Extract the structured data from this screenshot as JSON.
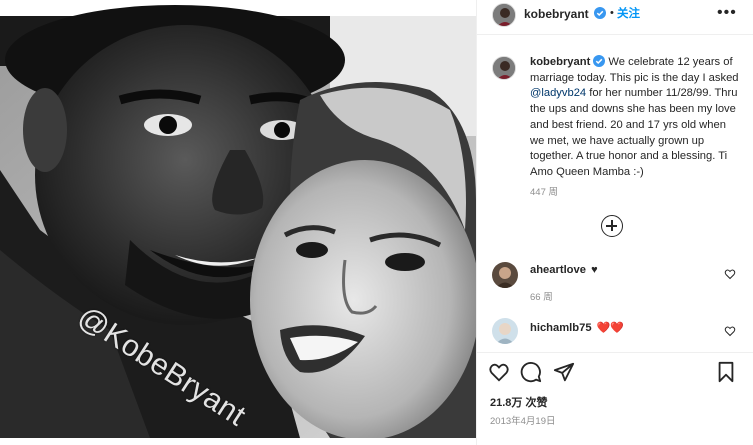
{
  "post": {
    "photo_watermark": "@KobeBryant"
  },
  "header": {
    "username": "kobebryant",
    "separator": "•",
    "follow_label": "关注",
    "more_label": "•••"
  },
  "caption": {
    "username": "kobebryant",
    "text_before_mention": "We celebrate 12 years of marriage today. This pic is the day I asked ",
    "mention": "@ladyvb24",
    "text_after_mention": " for her number 11/28/99. Thru the ups and downs she has been my love and best friend. 20 and 17 yrs old when we met, we have actually grown up together. A true honor and a blessing. Ti Amo Queen Mamba :-)",
    "time": "447 周"
  },
  "comments": [
    {
      "username": "aheartlove",
      "suffix": "♥",
      "meta": "66 周"
    },
    {
      "username": "hichamlb75",
      "suffix": "❤️❤️",
      "meta": ""
    }
  ],
  "footer": {
    "likes": "21.8万 次赞",
    "date": "2013年4月19日"
  },
  "colors": {
    "link_blue": "#0095f6",
    "mention_blue": "#00376b",
    "verified_blue": "#3897f0",
    "heart_red": "#ed4956",
    "muted_text": "#8e8e8e"
  },
  "icons": {
    "verified": "verified-badge-icon",
    "like": "heart-outline-icon",
    "comment": "comment-bubble-icon",
    "share": "paper-plane-icon",
    "save": "bookmark-icon",
    "load_more": "plus-circle-icon"
  }
}
